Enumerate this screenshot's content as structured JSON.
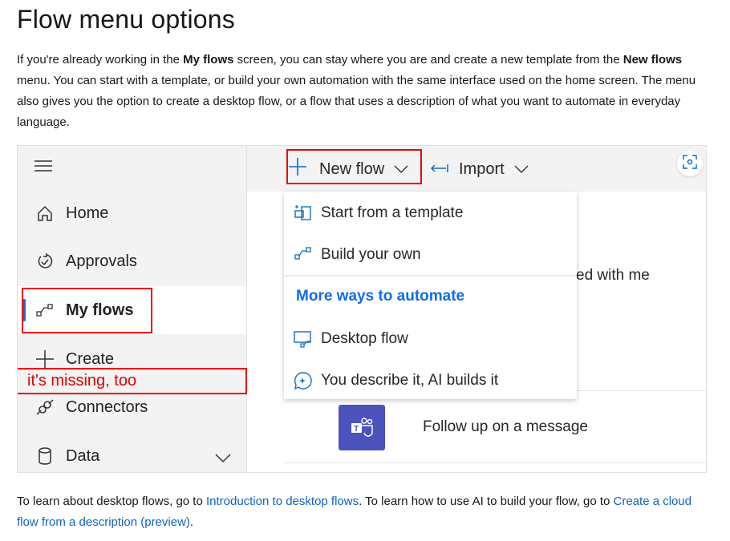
{
  "title": "Flow menu options",
  "intro": {
    "t1": "If you're already working in the ",
    "b1": "My flows",
    "t2": " screen, you can stay where you are and create a new template from the ",
    "b2": "New flows",
    "t3": " menu. You can start with a template, or build your own automation with the same interface used on the home screen. The menu also gives you the option to create a desktop flow, or a flow that uses a description of what you want to automate in everyday language."
  },
  "screenshot": {
    "sidebar": {
      "items": [
        {
          "label": "Home",
          "icon": "home-icon"
        },
        {
          "label": "Approvals",
          "icon": "approvals-icon"
        },
        {
          "label": "My flows",
          "icon": "flow-icon",
          "selected": true
        },
        {
          "label": "Create",
          "icon": "plus-icon"
        },
        {
          "label": "Connectors",
          "icon": "connector-icon"
        },
        {
          "label": "Data",
          "icon": "database-icon"
        }
      ]
    },
    "toolbar": {
      "new_flow": "New flow",
      "import": "Import"
    },
    "menu": {
      "items": [
        {
          "label": "Start from a template",
          "icon": "template-icon"
        },
        {
          "label": "Build your own",
          "icon": "flow-icon"
        }
      ],
      "section_header": "More ways to automate",
      "more_items": [
        {
          "label": "Desktop flow",
          "icon": "desktop-flow-icon"
        },
        {
          "label": "You describe it, AI builds it",
          "icon": "ai-chat-icon"
        }
      ]
    },
    "background": {
      "partial_text": "ed with me",
      "template_card": "Follow up on a message"
    },
    "annotation": "it's missing, too",
    "colors": {
      "accent": "#0f6cbd",
      "annotation": "#e00000",
      "teams": "#4b53bc"
    }
  },
  "outro": {
    "t1": "To learn about desktop flows, go to ",
    "link1": "Introduction to desktop flows",
    "t2": ". To learn how to use AI to build your flow, go to ",
    "link2": "Create a cloud flow from a description (preview)",
    "t3": "."
  }
}
